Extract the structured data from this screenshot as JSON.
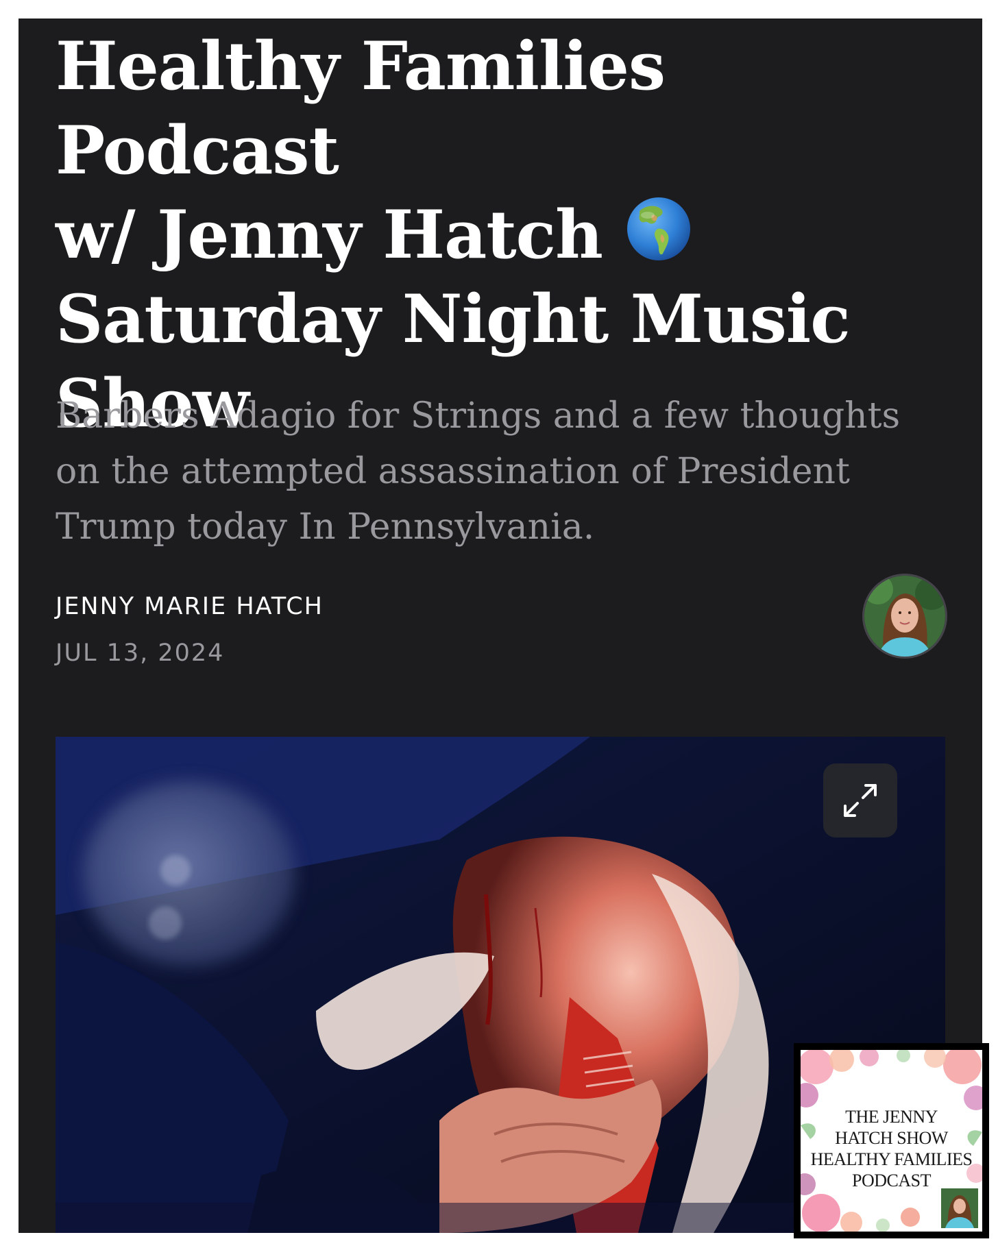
{
  "post": {
    "title_line1": "Healthy Families Podcast",
    "title_line2": "w/ Jenny Hatch",
    "title_emoji": "globe-americas-icon",
    "title_line3": "Saturday Night Music",
    "title_line4": "Show",
    "subtitle_line1": "Barbers Adagio for Strings and a few thoughts",
    "subtitle_line2": "on the attempted assassination of President",
    "subtitle_line3": "Trump today In Pennsylvania.",
    "author": "JENNY MARIE HATCH",
    "date": "JUL 13, 2024"
  },
  "hero_image": {
    "expand_icon": "expand-arrows-icon"
  },
  "podcast_thumbnail": {
    "line1": "THE JENNY",
    "line2": "HATCH SHOW",
    "line3": "HEALTHY FAMILIES",
    "line4": "PODCAST"
  },
  "colors": {
    "background": "#1c1c1e",
    "title": "#ffffff",
    "subtitle": "#9a9a9e",
    "date": "#9a9a9e",
    "page_frame": "#ffffff"
  }
}
